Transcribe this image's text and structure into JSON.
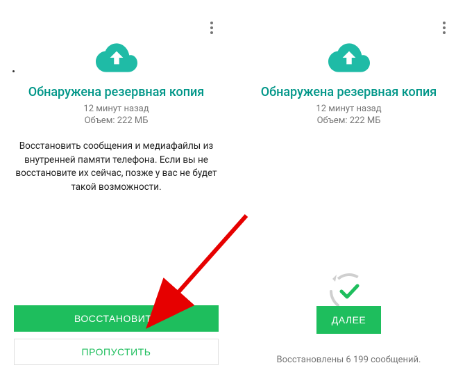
{
  "left": {
    "title": "Обнаружена резервная копия",
    "time_ago": "12 минут назад",
    "size": "Объем: 222 МБ",
    "description": "Восстановить сообщения и медиафайлы из внутренней памяти телефона. Если вы не восстановите их сейчас, позже у вас не будет такой возможности.",
    "restore_button": "ВОССТАНОВИТЬ",
    "skip_button": "ПРОПУСТИТЬ"
  },
  "right": {
    "title": "Обнаружена резервная копия",
    "time_ago": "12 минут назад",
    "size": "Объем: 222 МБ",
    "next_button": "ДАЛЕЕ",
    "status": "Восстановлены 6 199 сообщений."
  },
  "colors": {
    "teal": "#009688",
    "green": "#1ebe5d",
    "arrow": "#e60000"
  }
}
